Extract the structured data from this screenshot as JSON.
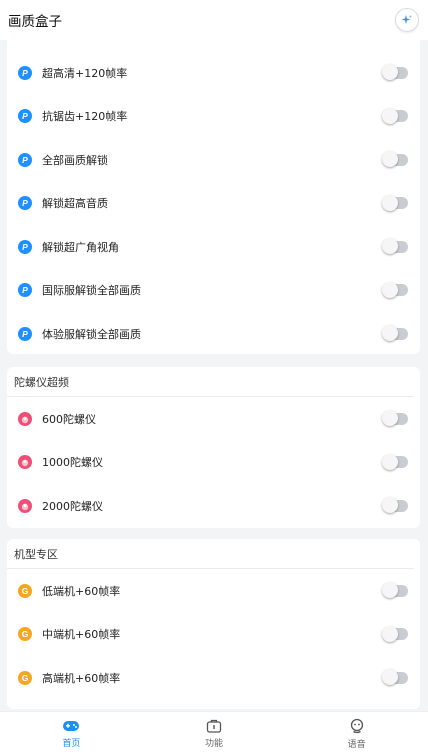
{
  "header": {
    "title": "画质盒子",
    "action_icon": "sparkle-icon"
  },
  "colors": {
    "accent": "#1c8ef0",
    "blue_icon": "#1e90ff",
    "pink_icon": "#ef4f74",
    "orange_icon": "#f5a623",
    "toggle_off": "#c9ccd1"
  },
  "quality_section": {
    "items": [
      {
        "label": "超高清+120帧率",
        "icon": "blue-p-icon",
        "on": false
      },
      {
        "label": "抗锯齿+120帧率",
        "icon": "blue-p-icon",
        "on": false
      },
      {
        "label": "全部画质解锁",
        "icon": "blue-p-icon",
        "on": false
      },
      {
        "label": "解锁超高音质",
        "icon": "blue-p-icon",
        "on": false
      },
      {
        "label": "解锁超广角视角",
        "icon": "blue-p-icon",
        "on": false
      },
      {
        "label": "国际服解锁全部画质",
        "icon": "blue-p-icon",
        "on": false
      },
      {
        "label": "体验服解锁全部画质",
        "icon": "blue-p-icon",
        "on": false
      }
    ]
  },
  "gyro_section": {
    "title": "陀螺仪超频",
    "items": [
      {
        "label": "600陀螺仪",
        "icon": "pink-icon",
        "on": false
      },
      {
        "label": "1000陀螺仪",
        "icon": "pink-icon",
        "on": false
      },
      {
        "label": "2000陀螺仪",
        "icon": "pink-icon",
        "on": false
      }
    ]
  },
  "model_section": {
    "title": "机型专区",
    "items": [
      {
        "label": "低端机+60帧率",
        "icon": "orange-g-icon",
        "on": false
      },
      {
        "label": "中端机+60帧率",
        "icon": "orange-g-icon",
        "on": false
      },
      {
        "label": "高端机+60帧率",
        "icon": "orange-g-icon",
        "on": false
      }
    ]
  },
  "tabs": [
    {
      "label": "首页",
      "icon": "home-gamepad-icon",
      "active": true
    },
    {
      "label": "功能",
      "icon": "toolbox-icon",
      "active": false
    },
    {
      "label": "语音",
      "icon": "voice-robot-icon",
      "active": false
    }
  ]
}
